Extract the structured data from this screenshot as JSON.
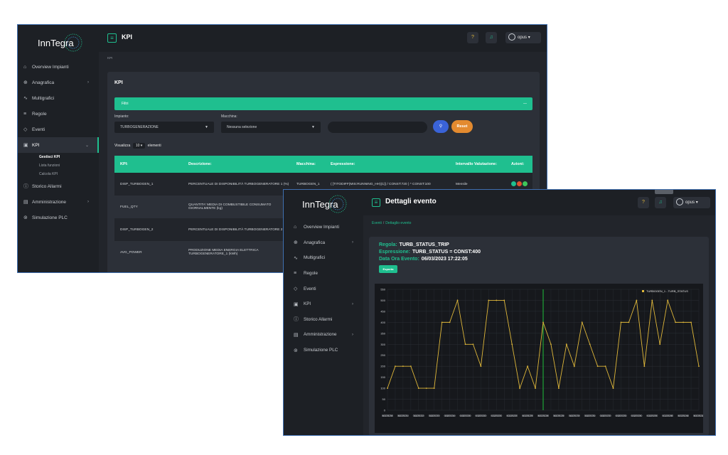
{
  "brand": "InnTegra",
  "colors": {
    "accent": "#1fbf8f",
    "sidebar": "#1d2025",
    "panel": "#2c3038",
    "line": "#e0b83a",
    "marker": "#1fbf3a"
  },
  "kpi_window": {
    "title": "KPI",
    "breadcrumb": "KPI",
    "panel_title": "KPI",
    "user": "opus",
    "sidebar": [
      {
        "icon": "home-icon",
        "label": "Overview Impianti"
      },
      {
        "icon": "globe-icon",
        "label": "Anagrafica",
        "chevron": true
      },
      {
        "icon": "chart-line-icon",
        "label": "Multigrafici"
      },
      {
        "icon": "sliders-icon",
        "label": "Regole"
      },
      {
        "icon": "layers-icon",
        "label": "Eventi"
      },
      {
        "icon": "kpi-icon",
        "label": "KPI",
        "chevron": true,
        "active": true
      },
      {
        "icon": "info-icon",
        "label": "Storico Allarmi"
      },
      {
        "icon": "building-icon",
        "label": "Amministrazione",
        "chevron": true
      },
      {
        "icon": "plc-icon",
        "label": "Simulazione PLC"
      }
    ],
    "kpi_sub": [
      "Gestisci KPI",
      "Lista funzioni",
      "Calcola KPI"
    ],
    "filters": {
      "bar_label": "Filtri",
      "bar_dash": "—",
      "impianto_label": "Impianto:",
      "impianto_value": "TURBOGENERAZIONE",
      "macchina_label": "Macchina:",
      "macchina_value": "Nessuna selezione",
      "reset_label": "Reset"
    },
    "show": {
      "prefix": "Visualizza",
      "value": "10",
      "suffix": "elementi"
    },
    "table": {
      "headers": [
        "KPI:",
        "Descrizione:",
        "Macchina:",
        "Espressione:",
        "Intervallo Valutazione:",
        "Azioni:"
      ],
      "rows": [
        [
          "DISP_TURBOGEN_1",
          "PERCENTUALE DI DISPONIBILITÀ TURBOGENERATORE 1 (%)",
          "TURBOGEN_1",
          "( [TITODIFF(MIS:RUNNING_HH)(1)] / CONST:720 ) * CONST:100",
          "Mensile",
          ""
        ],
        [
          "FUEL_QTY",
          "QUANTITA' MEDIA DI COMBUSTIBILE CONSUMATO GIORNALMENTE (kg)",
          "",
          "",
          "",
          ""
        ],
        [
          "DISP_TURBOGEN_2",
          "PERCENTUALE DI DISPONIBILITÀ TURBOGENERATORE 2 (%)",
          "",
          "",
          "",
          ""
        ],
        [
          "AVG_POWER",
          "PRODUZIONE MEDIA ENERGIA ELETTRICA TURBOGENERATORE_1 (kWh)",
          "",
          "",
          "",
          ""
        ]
      ]
    }
  },
  "event_window": {
    "title": "Dettagli evento",
    "user": "opus",
    "breadcrumb": [
      "Eventi",
      "Dettaglio evento"
    ],
    "sidebar": [
      {
        "icon": "home-icon",
        "label": "Overview Impianti"
      },
      {
        "icon": "globe-icon",
        "label": "Anagrafica",
        "chevron": true
      },
      {
        "icon": "chart-line-icon",
        "label": "Multigrafici"
      },
      {
        "icon": "sliders-icon",
        "label": "Regole"
      },
      {
        "icon": "layers-icon",
        "label": "Eventi"
      },
      {
        "icon": "kpi-icon",
        "label": "KPI",
        "chevron": true
      },
      {
        "icon": "info-icon",
        "label": "Storico Allarmi"
      },
      {
        "icon": "building-icon",
        "label": "Amministrazione",
        "chevron": true
      },
      {
        "icon": "plc-icon",
        "label": "Simulazione PLC"
      }
    ],
    "regola_label": "Regola:",
    "regola_value": "TURB_STATUS_TRIP",
    "espressione_label": "Espressione:",
    "espressione_value": "TURB_STATUS = CONST:400",
    "data_label": "Data Ora Evento:",
    "data_value": "06/03/2023 17:22:05",
    "export_label": "Esporta"
  },
  "chart_data": {
    "type": "line",
    "series": [
      {
        "name": "TURBOGEN_1 - TURB_STATUS",
        "values": [
          100,
          200,
          200,
          200,
          100,
          100,
          100,
          400,
          400,
          500,
          300,
          300,
          200,
          500,
          500,
          500,
          300,
          100,
          200,
          100,
          400,
          300,
          100,
          300,
          200,
          400,
          300,
          200,
          200,
          100,
          400,
          400,
          500,
          200,
          500,
          300,
          500,
          400,
          400,
          400,
          200
        ]
      }
    ],
    "ylim": [
      0,
      550
    ],
    "yticks": [
      0,
      50,
      100,
      150,
      200,
      250,
      300,
      350,
      400,
      450,
      500,
      550
    ],
    "xtick_labels": [
      "06-03-2023 17:21:00",
      "06-03-2023 17:21:10",
      "06-03-2023 17:21:20",
      "06-03-2023 17:21:30",
      "06-03-2023 17:21:40",
      "06-03-2023 17:21:50",
      "06-03-2023 17:22:00",
      "06-03-2023 17:22:10",
      "06-03-2023 17:22:20",
      "06-03-2023 17:22:30",
      "06-03-2023 17:22:40",
      "06-03-2023 17:22:50",
      "06-03-2023 17:23:00",
      "06-03-2023 17:23:10",
      "06-03-2023 17:23:20",
      "06-03-2023 17:23:30",
      "06-03-2023 17:23:40",
      "06-03-2023 17:23:50",
      "06-03-2023 17:24:00",
      "06-03-2023 17:24:10",
      "06-03-2023 17:24:20"
    ],
    "event_marker_index": 20,
    "legend": "top-right",
    "grid": true
  }
}
